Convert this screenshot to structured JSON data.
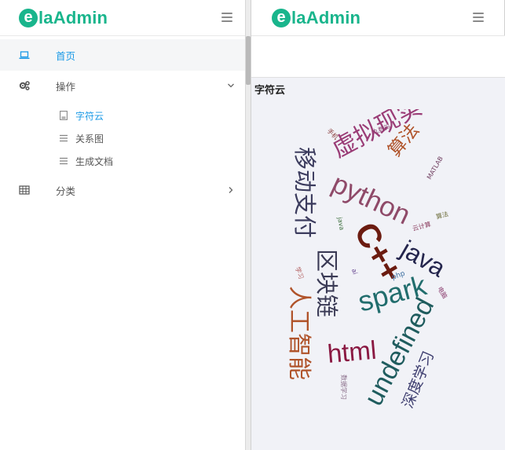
{
  "brand": {
    "logo_mark": "e",
    "logo_text": "laAdmin"
  },
  "sidebar": {
    "home": {
      "label": "首页",
      "icon": "laptop-icon"
    },
    "operations": {
      "label": "操作",
      "icon": "cogs-icon",
      "expanded": true,
      "children": [
        {
          "label": "字符云",
          "icon": "file-icon",
          "active": true
        },
        {
          "label": "关系图",
          "icon": "bars-icon"
        },
        {
          "label": "生成文档",
          "icon": "bars-icon"
        }
      ]
    },
    "category": {
      "label": "分类",
      "icon": "table-icon"
    }
  },
  "main": {
    "card_title": "字符云"
  },
  "colors": {
    "brand": "#19b58c",
    "active": "#1b9ae6",
    "content_bg": "#f1f2f7"
  },
  "wordcloud": {
    "words": [
      {
        "text": "虚拟现实",
        "color": "#9a3c76"
      },
      {
        "text": "移动支付",
        "color": "#3c3c5e"
      },
      {
        "text": "区块链",
        "color": "#3a3a55"
      },
      {
        "text": "人工智能",
        "color": "#b0532a"
      },
      {
        "text": "python",
        "color": "#8f4a69"
      },
      {
        "text": "C++",
        "color": "#6b1b10"
      },
      {
        "text": "java",
        "color": "#24254d"
      },
      {
        "text": "spark",
        "color": "#216d6d"
      },
      {
        "text": "html",
        "color": "#8a1942"
      },
      {
        "text": "undefined",
        "color": "#1f5c5e"
      },
      {
        "text": "算法",
        "color": "#b0532a"
      },
      {
        "text": "深度学习",
        "color": "#3c3c6e"
      },
      {
        "text": "手机",
        "color": "#8a3c3c"
      },
      {
        "text": "九数码",
        "color": "#8a3c6e"
      },
      {
        "text": "MATLAB",
        "color": "#6e3c5e"
      },
      {
        "text": "算法",
        "color": "#6e6e3c"
      },
      {
        "text": "云计算",
        "color": "#8a3c5e"
      },
      {
        "text": "java",
        "color": "#3c6e3c"
      },
      {
        "text": "php",
        "color": "#3c6ea0"
      },
      {
        "text": "学习",
        "color": "#b05a5a"
      },
      {
        "text": "ai",
        "color": "#5e3c8a"
      },
      {
        "text": "电脑",
        "color": "#8a3c6e"
      },
      {
        "text": "数据学习",
        "color": "#8a6e8a"
      }
    ]
  }
}
